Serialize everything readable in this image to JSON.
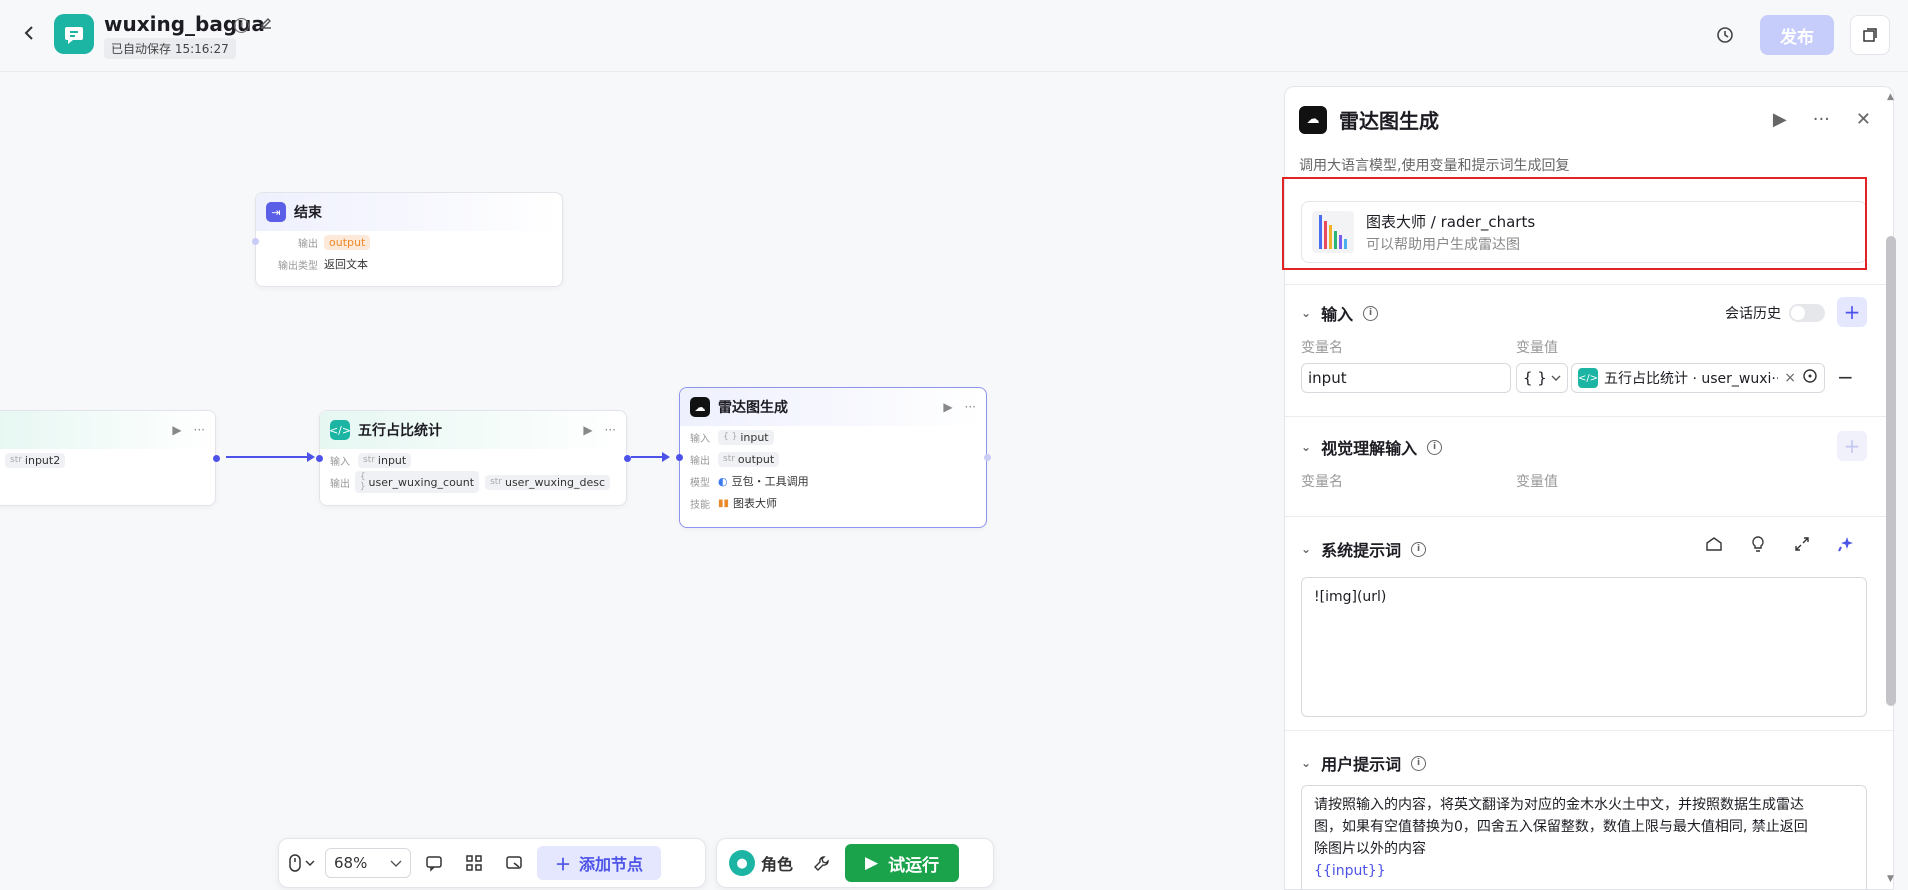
{
  "header": {
    "title": "wuxing_bagua",
    "autosave": "已自动保存 15:16:27",
    "publish_label": "发布"
  },
  "canvas": {
    "nodes": {
      "end": {
        "title": "结束",
        "output_label": "输出",
        "output_value": "output",
        "type_label": "输出类型",
        "type_value": "返回文本"
      },
      "left": {
        "input_type": "str",
        "input_value": "input2"
      },
      "wuxing": {
        "title": "五行占比统计",
        "input_label": "输入",
        "input_type": "str",
        "input_value": "input",
        "output_label": "输出",
        "output_1_type": "{ }",
        "output_1": "user_wuxing_count",
        "output_2_type": "str",
        "output_2": "user_wuxing_desc"
      },
      "radar": {
        "title": "雷达图生成",
        "input_label": "输入",
        "input_type": "{ }",
        "input_value": "input",
        "output_label": "输出",
        "output_type": "str",
        "output_value": "output",
        "model_label": "模型",
        "model_value": "豆包・工具调用",
        "skill_label": "技能",
        "skill_value": "图表大师"
      }
    }
  },
  "toolbar": {
    "zoom": "68%",
    "add_node_label": "添加节点",
    "role_label": "角色",
    "run_label": "试运行"
  },
  "panel": {
    "title": "雷达图生成",
    "description": "调用大语言模型,使用变量和提示词生成回复",
    "skill": {
      "name": "图表大师 / rader_charts",
      "desc": "可以帮助用户生成雷达图"
    },
    "input_section": {
      "title": "输入",
      "history_label": "会话历史",
      "col_name": "变量名",
      "col_value": "变量值",
      "var_name": "input",
      "var_type": "{ }",
      "var_ref": "五行占比统计 · user_wuxi···"
    },
    "vision_section": {
      "title": "视觉理解输入",
      "col_name": "变量名",
      "col_value": "变量值"
    },
    "system_prompt": {
      "title": "系统提示词",
      "content": "![img](url)"
    },
    "user_prompt": {
      "title": "用户提示词",
      "line1": "请按照输入的内容，将英文翻译为对应的金木水火土中文，并按照数据生成雷达",
      "line2": "图，如果有空值替换为0，四舍五入保留整数，数值上限与最大值相同, 禁止返回",
      "line3": "除图片以外的内容",
      "var": "{{input}}"
    }
  },
  "colors": {
    "accent": "#4d53e8",
    "run_green": "#1aa34a",
    "highlight_red": "#e02424",
    "app_teal": "#1cb5a3"
  }
}
